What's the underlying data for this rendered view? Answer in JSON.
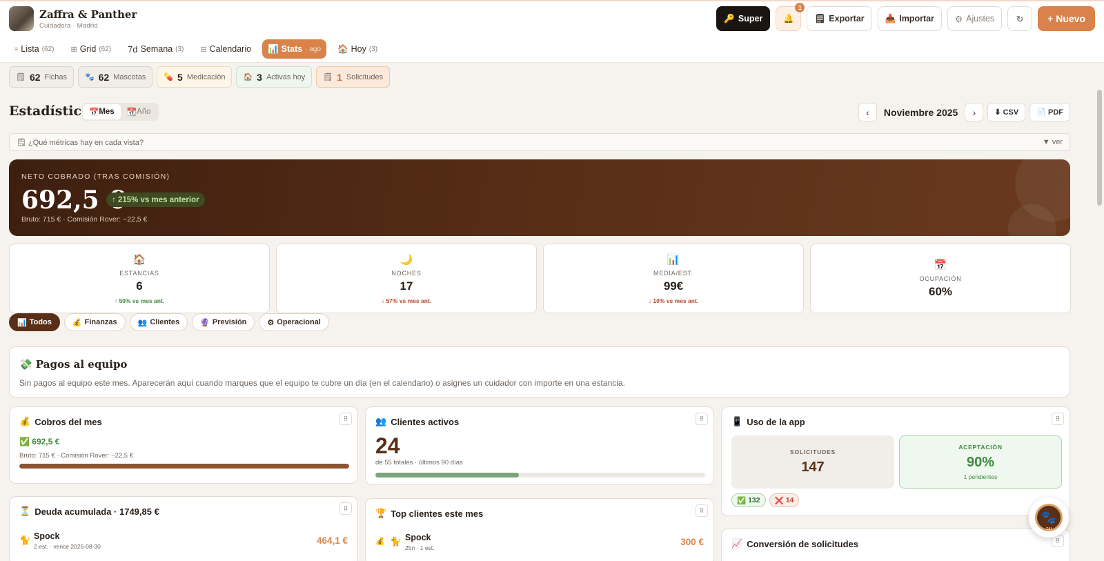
{
  "brand": {
    "name": "Zaffra & Panther",
    "subtitle": "Cuidadora · Madrid"
  },
  "header": {
    "super": "Super",
    "notifications": "1",
    "exportar": "Exportar",
    "importar": "Importar",
    "ajustes": "Ajustes",
    "nuevo": "+ Nuevo"
  },
  "tabs": [
    {
      "label": "Lista",
      "count": "(62)"
    },
    {
      "label": "Grid",
      "count": "(62)"
    },
    {
      "label": "Semana",
      "count": "(3)"
    },
    {
      "label": "Calendario",
      "count": ""
    },
    {
      "label": "Stats",
      "count": "· ago"
    },
    {
      "label": "Hoy",
      "count": "(3)"
    }
  ],
  "summary": [
    {
      "value": "62",
      "label": "Fichas"
    },
    {
      "value": "62",
      "label": "Mascotas"
    },
    {
      "value": "5",
      "label": "Medicación"
    },
    {
      "value": "3",
      "label": "Activas hoy"
    },
    {
      "value": "1",
      "label": "Solicitudes"
    }
  ],
  "stats": {
    "title": "Estadísticas",
    "mes": "Mes",
    "anio": "Año",
    "month": "Noviembre 2025",
    "csv": "CSV",
    "pdf": "PDF",
    "info": "¿Qué métricas hay en cada vista?",
    "info_action": "ver"
  },
  "hero": {
    "label": "NETO COBRADO (TRAS COMISIÓN)",
    "value": "692,5 €",
    "delta": "↑ 215% vs mes anterior",
    "sub": "Bruto: 715 € · Comisión Rover: −22,5 €"
  },
  "kpis": [
    {
      "label": "ESTANCIAS",
      "value": "6",
      "delta": "↑ 50% vs mes ant."
    },
    {
      "label": "NOCHES",
      "value": "17",
      "delta": "↓ 57% vs mes ant."
    },
    {
      "label": "MEDIA/EST.",
      "value": "99€",
      "delta": "↓ 10% vs mes ant."
    },
    {
      "label": "OCUPACIÓN",
      "value": "60%",
      "delta": ""
    }
  ],
  "filters": [
    "Todos",
    "Finanzas",
    "Clientes",
    "Previsión",
    "Operacional"
  ],
  "pagos": {
    "title": "Pagos al equipo",
    "text": "Sin pagos al equipo este mes. Aparecerán aquí cuando marques que el equipo te cubre un día (en el calendario) o asignes un cuidador con importe en una estancia."
  },
  "cobros": {
    "title": "Cobros del mes",
    "value": "692,5 €",
    "sub": "Bruto: 715 € · Comisión Rover: −22,5 €",
    "progress": 1.0
  },
  "clientes": {
    "title": "Clientes activos",
    "value": "24",
    "sub": "de 55 totales · últimos 90 días",
    "progress": 0.436
  },
  "uso": {
    "title": "Uso de la app",
    "solicitudes_label": "SOLICITUDES",
    "solicitudes_value": "147",
    "aceptacion_label": "ACEPTACIÓN",
    "aceptacion_value": "90%",
    "pendientes": "1 pendientes",
    "accepted": "132",
    "rejected": "14"
  },
  "deuda": {
    "title": "Deuda acumulada · 1749,85 €",
    "item_name": "Spock",
    "item_sub": "2 est. · vence 2026-08-30",
    "item_amount": "464,1 €"
  },
  "top": {
    "title": "Top clientes este mes",
    "item_name": "Spock",
    "item_sub": "25n · 1 est.",
    "item_amount": "300 €"
  },
  "conversion": {
    "title": "Conversión de solicitudes"
  },
  "fab": {
    "label": "ZAI"
  },
  "colors": {
    "accent": "#d9834b",
    "brown": "#5a2f17",
    "green": "#3e8a3e",
    "red": "#b5472a"
  }
}
